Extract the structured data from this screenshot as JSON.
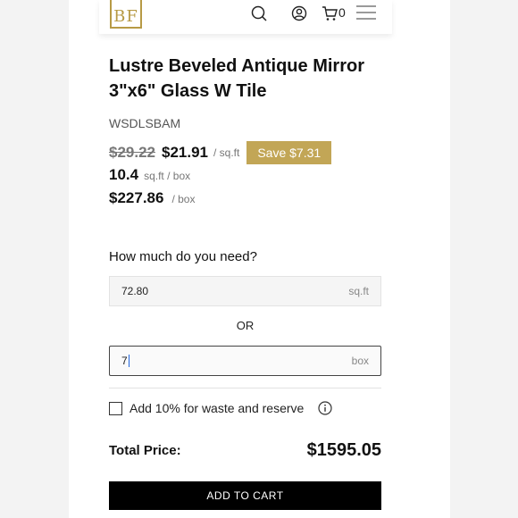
{
  "header": {
    "logo_text": "BF",
    "icons": [
      "search-icon",
      "user-icon",
      "cart-icon",
      "menu-icon"
    ],
    "cart_count": "0"
  },
  "product": {
    "title": "Lustre Beveled Antique Mirror 3\"x6\" Glass W Tile",
    "sku": "WSDLSBAM",
    "old_price": "$29.22",
    "new_price": "$21.91",
    "price_unit": "/ sq.ft",
    "save_badge": "Save $7.31",
    "coverage_value": "10.4",
    "coverage_unit": "sq.ft / box",
    "box_price": "$227.86",
    "box_price_unit": "/ box"
  },
  "calculator": {
    "question": "How much do you need?",
    "sqft_value": "72.80",
    "sqft_unit": "sq.ft",
    "or_text": "OR",
    "box_value": "7",
    "box_unit": "box",
    "waste_label": "Add 10% for waste and reserve",
    "waste_checked": false
  },
  "total": {
    "label": "Total Price:",
    "value": "$1595.05"
  },
  "cta": {
    "add_to_cart": "ADD TO CART"
  },
  "colors": {
    "brand_gold": "#c2a656",
    "button_black": "#000000"
  }
}
